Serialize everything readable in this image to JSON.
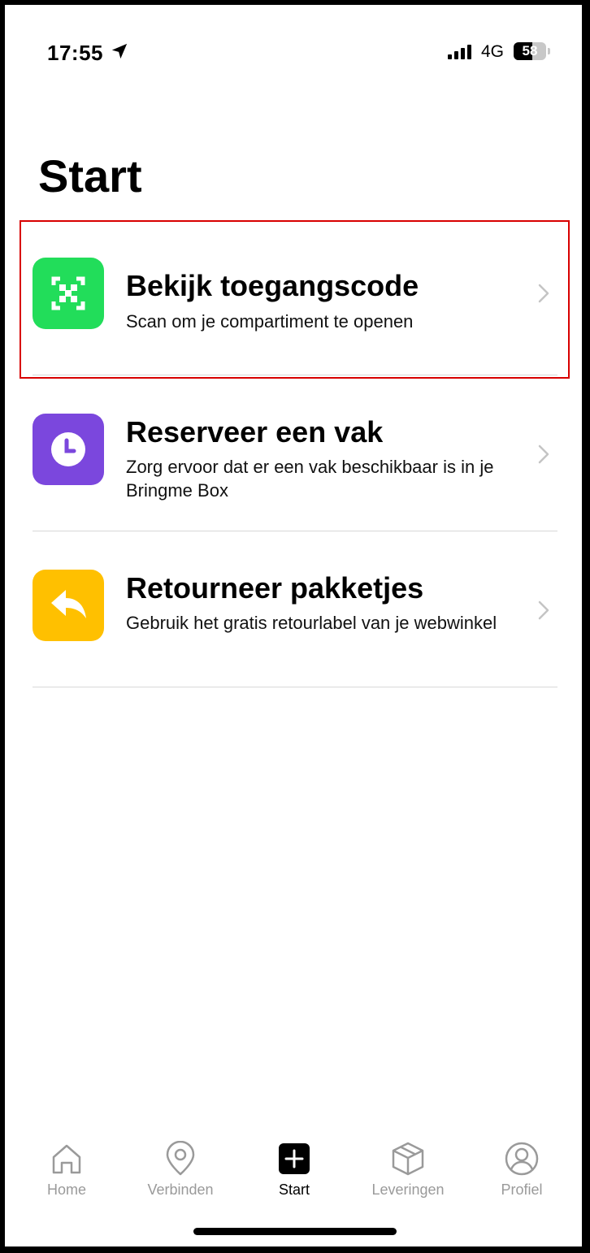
{
  "status_bar": {
    "time": "17:55",
    "network": "4G",
    "battery": "58",
    "battery_level": 0.58
  },
  "page": {
    "title": "Start"
  },
  "items": [
    {
      "title": "Bekijk toegangscode",
      "subtitle": "Scan om je compartiment te openen",
      "icon": "qr-code-icon",
      "color": "#22DD5A",
      "highlighted": true
    },
    {
      "title": "Reserveer een vak",
      "subtitle": "Zorg ervoor dat er een vak beschikbaar is in je Bringme Box",
      "icon": "clock-icon",
      "color": "#7B47DD"
    },
    {
      "title": "Retourneer pakketjes",
      "subtitle": "Gebruik het gratis retourlabel van je webwinkel",
      "icon": "reply-arrow-icon",
      "color": "#FFC000"
    }
  ],
  "tabs": [
    {
      "label": "Home",
      "icon": "home-icon",
      "active": false
    },
    {
      "label": "Verbinden",
      "icon": "location-pin-icon",
      "active": false
    },
    {
      "label": "Start",
      "icon": "plus-icon",
      "active": true
    },
    {
      "label": "Leveringen",
      "icon": "package-icon",
      "active": false
    },
    {
      "label": "Profiel",
      "icon": "profile-icon",
      "active": false
    }
  ],
  "colors": {
    "inactive_tab": "#9A9A9A",
    "active_tab": "#000000",
    "highlight_border": "#D80000",
    "chevron": "#C4C4C4"
  }
}
